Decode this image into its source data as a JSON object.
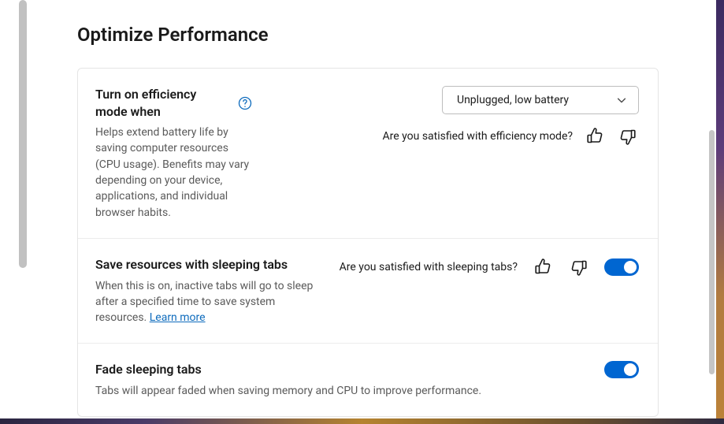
{
  "heading": "Optimize Performance",
  "efficiency": {
    "title": "Turn on efficiency mode when",
    "desc": "Helps extend battery life by saving computer resources (CPU usage). Benefits may vary depending on your device, applications, and individual browser habits.",
    "dropdown_value": "Unplugged, low battery",
    "feedback_prompt": "Are you satisfied with efficiency mode?"
  },
  "sleeping_tabs": {
    "title": "Save resources with sleeping tabs",
    "desc_prefix": "When this is on, inactive tabs will go to sleep after a specified time to save system resources. ",
    "learn_more": "Learn more",
    "feedback_prompt": "Are you satisfied with sleeping tabs?"
  },
  "fade_tabs": {
    "title": "Fade sleeping tabs",
    "desc": "Tabs will appear faded when saving memory and CPU to improve performance."
  }
}
